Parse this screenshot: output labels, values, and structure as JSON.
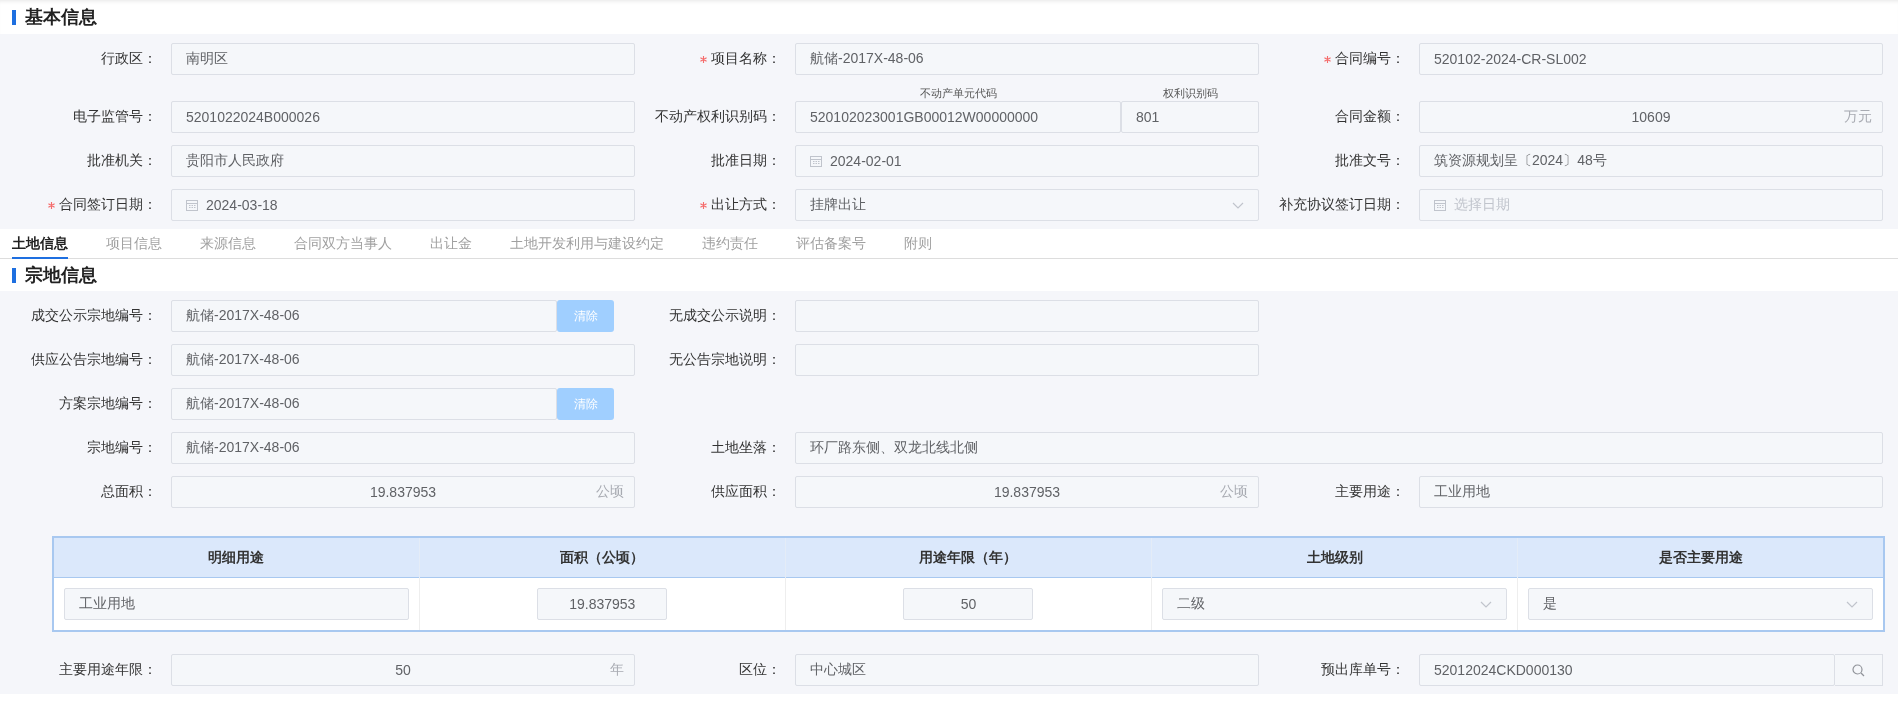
{
  "basic_info": {
    "title": "基本信息",
    "rows": [
      [
        {
          "label": "行政区：",
          "required": false,
          "kind": "text",
          "value": "南明区"
        },
        {
          "label": "项目名称：",
          "required": true,
          "kind": "text",
          "value": "航储-2017X-48-06"
        },
        {
          "label": "合同编号：",
          "required": true,
          "kind": "text",
          "value": "520102-2024-CR-SL002"
        }
      ],
      [
        {
          "label": "电子监管号：",
          "required": false,
          "kind": "text",
          "value": "5201022024B000026"
        },
        {
          "label": "不动产权利识别码：",
          "required": false,
          "kind": "split",
          "parts": [
            {
              "caption": "不动产单元代码",
              "value": "520102023001GB00012W00000000"
            },
            {
              "caption": "权利识别码",
              "value": "801"
            }
          ]
        },
        {
          "label": "合同金额：",
          "required": false,
          "kind": "amount",
          "value": "10609",
          "unit": "万元"
        }
      ],
      [
        {
          "label": "批准机关：",
          "required": false,
          "kind": "text",
          "value": "贵阳市人民政府"
        },
        {
          "label": "批准日期：",
          "required": false,
          "kind": "date",
          "value": "2024-02-01"
        },
        {
          "label": "批准文号：",
          "required": false,
          "kind": "text",
          "value": "筑资源规划呈〔2024〕48号"
        }
      ],
      [
        {
          "label": "合同签订日期：",
          "required": true,
          "kind": "date",
          "value": "2024-03-18"
        },
        {
          "label": "出让方式：",
          "required": true,
          "kind": "select",
          "value": "挂牌出让"
        },
        {
          "label": "补充协议签订日期：",
          "required": false,
          "kind": "date",
          "placeholder": "选择日期"
        }
      ]
    ]
  },
  "tabs": [
    {
      "label": "土地信息",
      "selected": true
    },
    {
      "label": "项目信息",
      "selected": false
    },
    {
      "label": "来源信息",
      "selected": false
    },
    {
      "label": "合同双方当事人",
      "selected": false
    },
    {
      "label": "出让金",
      "selected": false
    },
    {
      "label": "土地开发利用与建设约定",
      "selected": false
    },
    {
      "label": "违约责任",
      "selected": false
    },
    {
      "label": "评估备案号",
      "selected": false
    },
    {
      "label": "附则",
      "selected": false
    }
  ],
  "parcel_info": {
    "title": "宗地信息",
    "rows": [
      [
        {
          "label": "成交公示宗地编号：",
          "required": false,
          "kind": "clearable",
          "value": "航储-2017X-48-06",
          "action": "清除"
        },
        {
          "label": "无成交公示说明：",
          "required": false,
          "kind": "text"
        }
      ],
      [
        {
          "label": "供应公告宗地编号：",
          "required": false,
          "kind": "text",
          "value": "航储-2017X-48-06"
        },
        {
          "label": "无公告宗地说明：",
          "required": false,
          "kind": "text"
        }
      ],
      [
        {
          "label": "方案宗地编号：",
          "required": false,
          "kind": "clearable",
          "value": "航储-2017X-48-06",
          "action": "清除"
        }
      ],
      [
        {
          "label": "宗地编号：",
          "required": false,
          "kind": "text",
          "value": "航储-2017X-48-06"
        },
        {
          "label": "土地坐落：",
          "required": false,
          "kind": "wide",
          "value": "环厂路东侧、双龙北线北侧"
        }
      ],
      [
        {
          "label": "总面积：",
          "required": false,
          "kind": "amount",
          "value": "19.837953",
          "unit": "公顷"
        },
        {
          "label": "供应面积：",
          "required": false,
          "kind": "amount",
          "value": "19.837953",
          "unit": "公顷"
        },
        {
          "label": "主要用途：",
          "required": false,
          "kind": "text",
          "value": "工业用地"
        }
      ]
    ],
    "detail_table": {
      "columns": [
        "明细用途",
        "面积（公顷）",
        "用途年限（年）",
        "土地级别",
        "是否主要用途"
      ],
      "rows": [
        {
          "cells": [
            {
              "kind": "text",
              "value": "工业用地"
            },
            {
              "kind": "number",
              "value": "19.837953"
            },
            {
              "kind": "number",
              "value": "50"
            },
            {
              "kind": "select",
              "value": "二级"
            },
            {
              "kind": "select",
              "value": "是"
            }
          ]
        }
      ]
    },
    "more_rows": [
      [
        {
          "label": "主要用途年限：",
          "required": false,
          "kind": "amount",
          "value": "50",
          "unit": "年"
        },
        {
          "label": "区位：",
          "required": false,
          "kind": "text",
          "value": "中心城区"
        },
        {
          "label": "预出库单号：",
          "required": false,
          "kind": "lookup",
          "value": "52012024CKD000130"
        }
      ]
    ]
  }
}
